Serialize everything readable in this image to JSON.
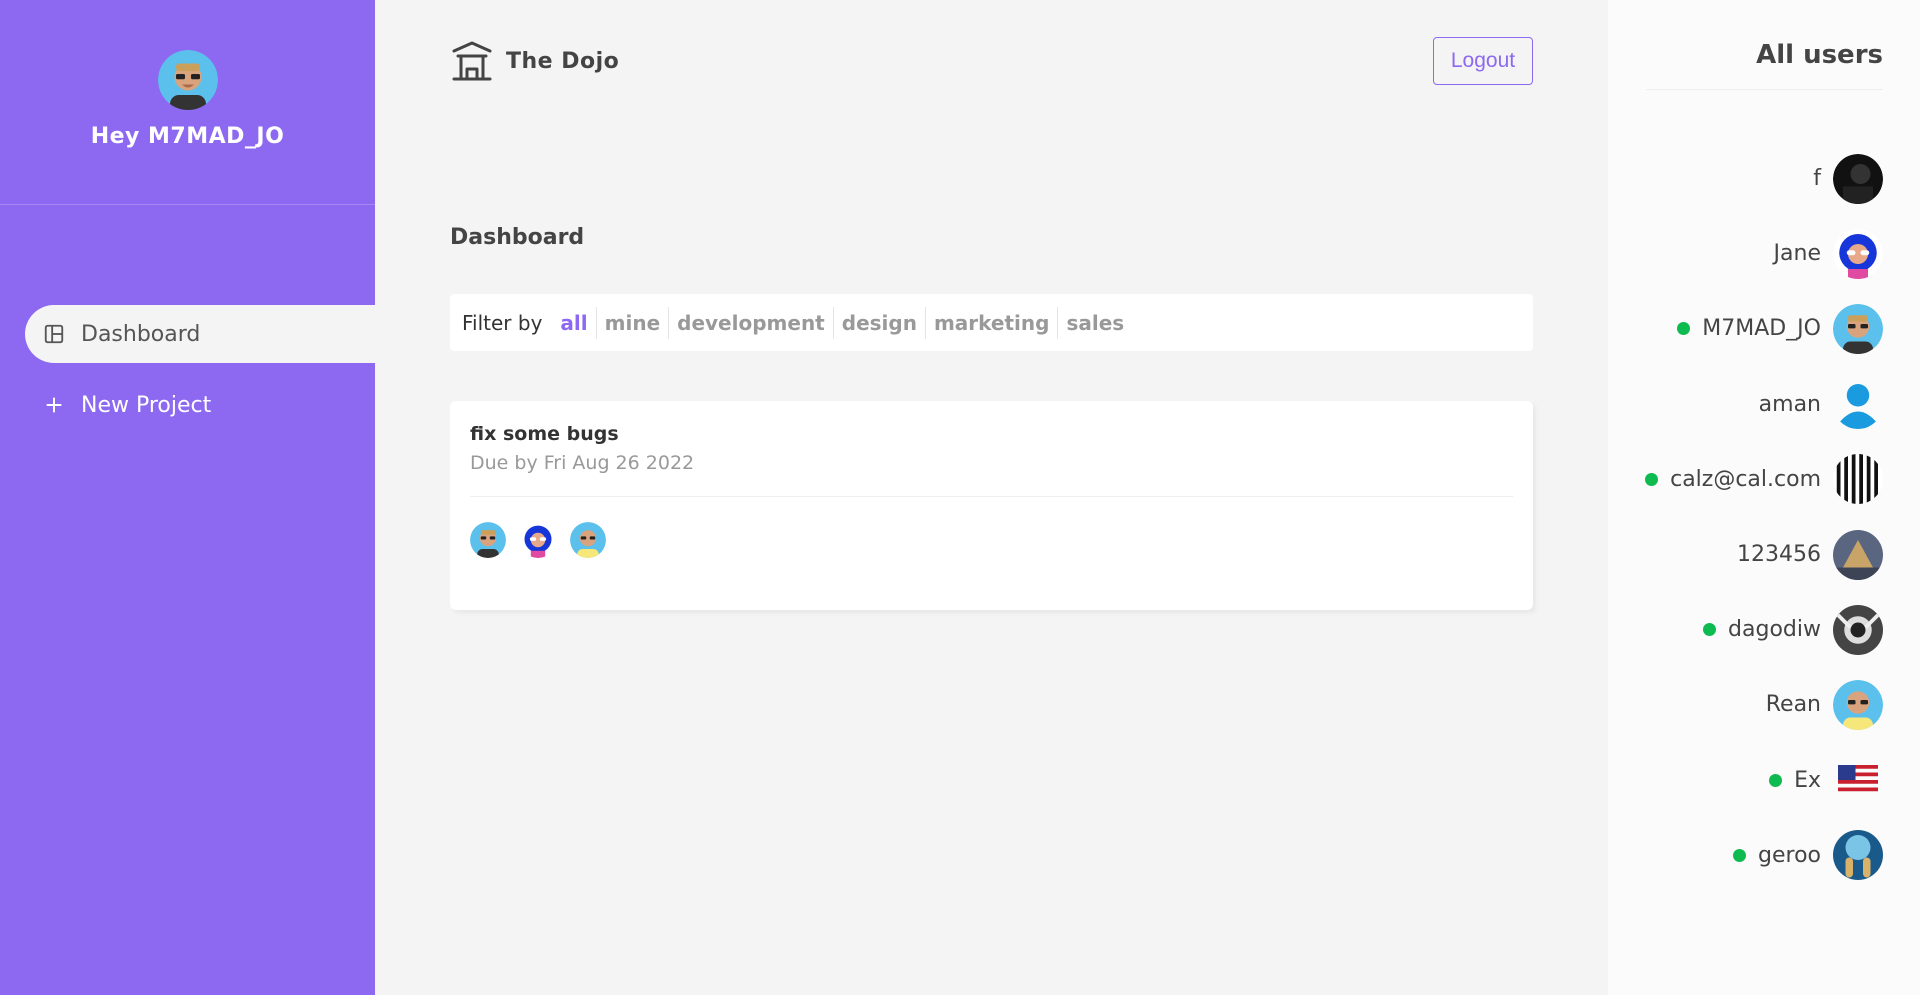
{
  "sidebar": {
    "greeting": "Hey M7MAD_JO",
    "items": [
      {
        "label": "Dashboard",
        "icon": "dashboard-icon",
        "active": true
      },
      {
        "label": "New Project",
        "icon": "plus-icon",
        "active": false
      }
    ]
  },
  "navbar": {
    "brand": "The Dojo",
    "logout_label": "Logout"
  },
  "main": {
    "title": "Dashboard",
    "filter": {
      "label": "Filter by",
      "options": [
        "all",
        "mine",
        "development",
        "design",
        "marketing",
        "sales"
      ],
      "active": "all"
    },
    "projects": [
      {
        "name": "fix some bugs",
        "due": "Due by Fri Aug 26 2022",
        "assignees": [
          "M7MAD_JO",
          "Jane",
          "Rean"
        ]
      }
    ]
  },
  "users": {
    "title": "All users",
    "list": [
      {
        "name": "f",
        "online": false
      },
      {
        "name": "Jane",
        "online": false
      },
      {
        "name": "M7MAD_JO",
        "online": true
      },
      {
        "name": "aman",
        "online": false
      },
      {
        "name": "calz@cal.com",
        "online": true
      },
      {
        "name": "123456",
        "online": false
      },
      {
        "name": "dagodiw",
        "online": true
      },
      {
        "name": "Rean",
        "online": false
      },
      {
        "name": "Ex",
        "online": true
      },
      {
        "name": "geroo",
        "online": true
      }
    ]
  },
  "colors": {
    "accent": "#8d69f1",
    "online": "#0ebb50",
    "background": "#f4f4f4"
  }
}
